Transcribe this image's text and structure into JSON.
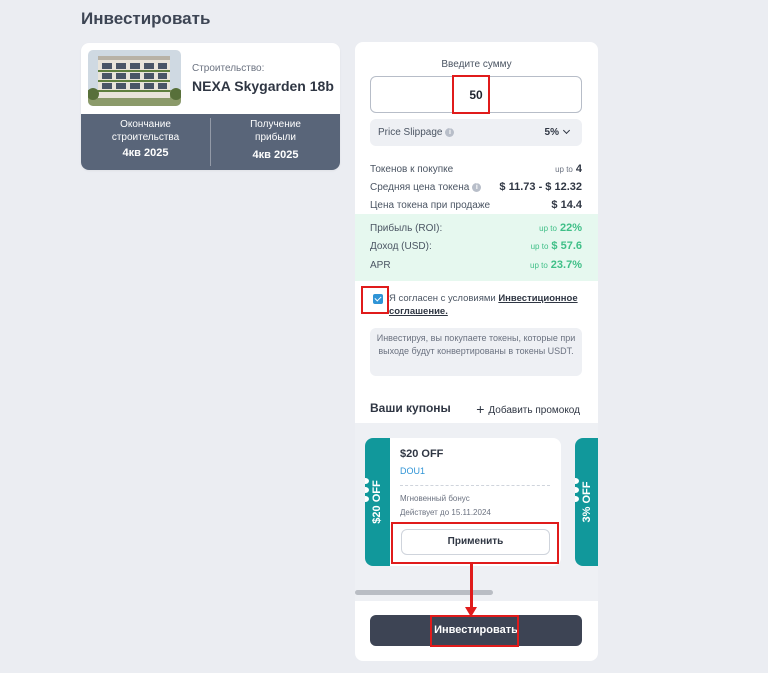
{
  "page": {
    "title": "Инвестировать"
  },
  "project": {
    "subtitle": "Строительство:",
    "name": "NEXA Skygarden 18b",
    "completion_label": "Окончание строительства",
    "completion_value": "4кв 2025",
    "profit_label": "Получение прибыли",
    "profit_value": "4кв 2025"
  },
  "invest": {
    "amount_label": "Введите сумму",
    "amount_value": "50",
    "slippage_label": "Price Slippage",
    "slippage_value": "5%",
    "tokens_label": "Токенов к покупке",
    "tokens_upto": "up to",
    "tokens_value": "4",
    "avg_price_label": "Средняя цена токена",
    "avg_price_value": "$ 11.73 - $ 12.32",
    "sell_price_label": "Цена токена при продаже",
    "sell_price_value": "$ 14.4",
    "roi_label": "Прибыль (ROI):",
    "roi_upto": "up to",
    "roi_value": "22%",
    "income_label": "Доход (USD):",
    "income_upto": "up to",
    "income_value": "$ 57.6",
    "apr_label": "APR",
    "apr_upto": "up to",
    "apr_value": "23.7%",
    "agree_text": "Я согласен с условиями ",
    "agree_link": "Инвестиционное соглашение.",
    "agree_checked": true,
    "note": "Инвестируя, вы покупаете токены, которые при выходе будут конвертированы в токены USDT.",
    "submit_label": "Инвестировать"
  },
  "coupons": {
    "title": "Ваши купоны",
    "add_promo_label": "Добавить промокод",
    "items": [
      {
        "side_label": "$20 OFF",
        "title": "$20 OFF",
        "code": "DOU1",
        "bonus_type": "Мгновенный бонус",
        "valid_until": "Действует до 15.11.2024",
        "apply_label": "Применить"
      },
      {
        "side_label": "3% OFF"
      }
    ]
  },
  "colors": {
    "accent_teal": "#11989b",
    "profit_green": "#3fbf87",
    "link_blue": "#2f94d6",
    "dark_button": "#3d4454",
    "annotation_red": "#e01b1b"
  }
}
